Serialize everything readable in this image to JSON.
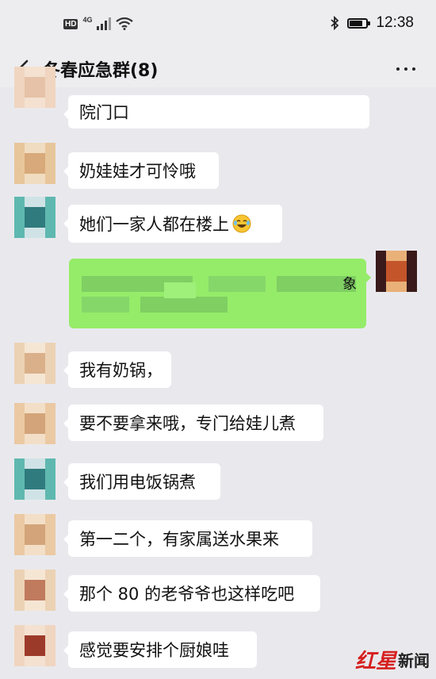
{
  "status_bar": {
    "hd": "HD",
    "network": "4G",
    "time": "12:38",
    "battery_level": 0.85
  },
  "header": {
    "title": "冬春应急群(8)"
  },
  "messages": [
    {
      "side": "left",
      "text": "院门口",
      "avatar_colors": [
        "#f0d5c0",
        "#e6c2a8",
        "#f4e1d0"
      ]
    },
    {
      "side": "left",
      "text": "奶娃娃才可怜哦",
      "avatar_colors": [
        "#e8c69b",
        "#d8a97a",
        "#f0dcc0"
      ]
    },
    {
      "side": "left",
      "text": "她们一家人都在楼上",
      "avatar_colors": [
        "#5fb8b0",
        "#2f7b7d",
        "#cfe3e6"
      ],
      "emoji": "laugh-cry-emoji"
    },
    {
      "side": "right",
      "text": "象",
      "avatar_colors": [
        "#3a1a1a",
        "#c4552a",
        "#e9b078"
      ]
    },
    {
      "side": "left",
      "text": "我有奶锅，",
      "avatar_colors": [
        "#ecd2b4",
        "#d9b08a",
        "#f5e6d4"
      ]
    },
    {
      "side": "left",
      "text": "要不要拿来哦，专门给娃儿煮",
      "avatar_colors": [
        "#ebc9a3",
        "#d3a47a",
        "#f3dfc7"
      ]
    },
    {
      "side": "left",
      "text": "我们用电饭锅煮",
      "avatar_colors": [
        "#5fb8b0",
        "#2f7b7d",
        "#cfe3e6"
      ]
    },
    {
      "side": "left",
      "text": "第一二个，有家属送水果来",
      "avatar_colors": [
        "#ebc9a3",
        "#d3a47a",
        "#f3dfc7"
      ]
    },
    {
      "side": "left",
      "text": "那个 80 的老爷爷也这样吃吧",
      "avatar_colors": [
        "#ecd2b4",
        "#c07a5e",
        "#f5e6d4"
      ]
    },
    {
      "side": "left",
      "text": "感觉要安排个厨娘哇",
      "avatar_colors": [
        "#f0d5c0",
        "#9c3a2a",
        "#f4e1d0"
      ]
    }
  ],
  "watermark": {
    "brand_red": "红星",
    "brand_dark": "新闻"
  }
}
